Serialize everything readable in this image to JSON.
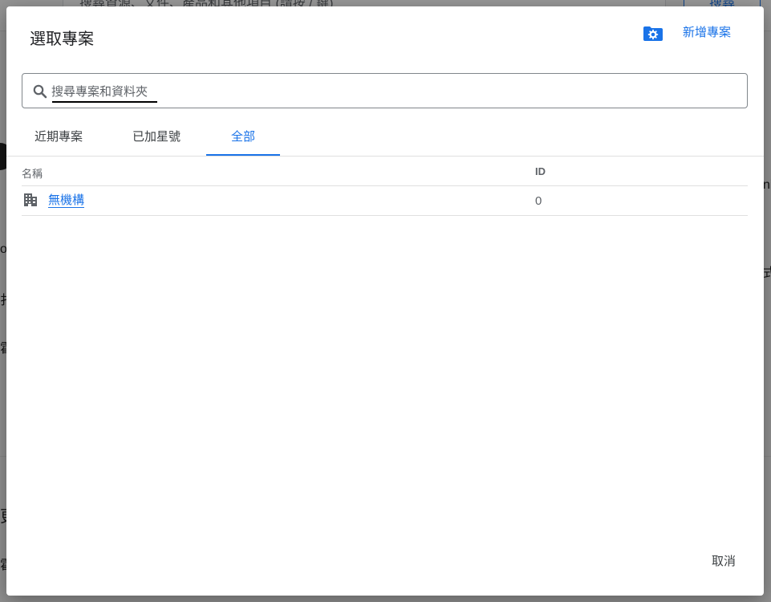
{
  "background": {
    "search_placeholder": "搜尋資源、文件、產品和其他項目 (請按 / 鍵)",
    "search_button": "搜尋",
    "frag_right_1": "ni",
    "frag_right_2": "式",
    "frag_left_1": "o",
    "frag_left_2": "扌",
    "frag_left_3": "霍",
    "frag_left_4": "更",
    "frag_left_5": "霍"
  },
  "dialog": {
    "title": "選取專案",
    "manage_icon": "folder-gear-icon",
    "new_project": "新增專案",
    "search": {
      "placeholder": "搜尋專案和資料夾",
      "value": ""
    },
    "tabs": [
      {
        "label": "近期專案",
        "active": false
      },
      {
        "label": "已加星號",
        "active": false
      },
      {
        "label": "全部",
        "active": true
      }
    ],
    "table": {
      "columns": [
        "名稱",
        "ID"
      ],
      "rows": [
        {
          "icon": "building-icon",
          "name": "無機構",
          "id": "0"
        }
      ]
    },
    "cancel": "取消"
  },
  "colors": {
    "accent": "#1a73e8",
    "text": "#202124",
    "muted": "#5f6368"
  }
}
